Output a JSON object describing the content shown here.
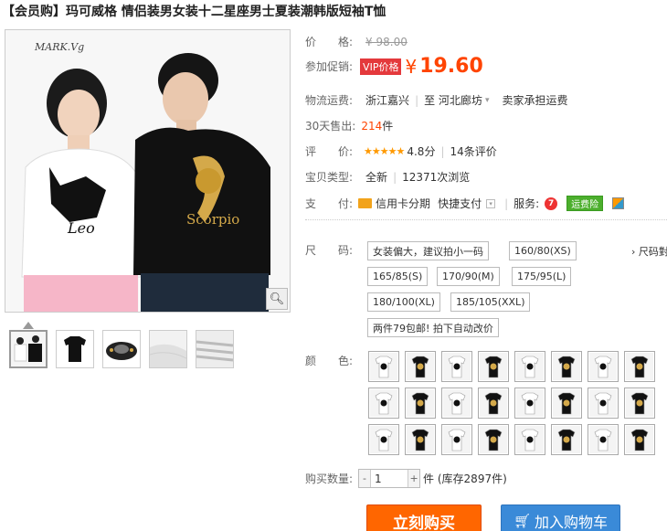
{
  "title": "【会员购】玛可威格 情侣装男女装十二星座男士夏装潮韩版短袖T恤",
  "product": {
    "price_label": "价　　格:",
    "old_price": "¥ 98.00",
    "promo_label": "参加促销:",
    "vip_badge": "VIP价格",
    "currency": "¥",
    "price": "19.60",
    "shipping_label": "物流运费:",
    "ship_from": "浙江嘉兴",
    "ship_to": "至  河北廊坊",
    "shipping_note": "卖家承担运费",
    "sold_label": "30天售出:",
    "sold_count": "214",
    "sold_unit": "件",
    "rating_label": "评　　价:",
    "stars": "★★★★★",
    "rating_score": "4.8分",
    "review_count": "14条评价",
    "type_label": "宝贝类型:",
    "type_value": "全新",
    "views": "12371次浏览",
    "pay_label": "支　　付:",
    "pay_credit": "信用卡分期",
    "pay_fast": "快捷支付",
    "service_label": "服务:",
    "service_badge": "运费险"
  },
  "photo": {
    "logo": "MARK.Vg",
    "left_print": "Leo",
    "right_print": "Scorpio"
  },
  "size": {
    "label": "尺　　码:",
    "hint": "女装偏大，建议拍小一码",
    "chart_link": "› 尺码對",
    "options": [
      "160/80(XS)",
      "165/85(S)",
      "170/90(M)",
      "175/95(L)",
      "180/100(XL)",
      "185/105(XXL)"
    ],
    "promo": "两件79包邮! 拍下自动改价"
  },
  "color": {
    "label": "颜　　色:"
  },
  "quantity": {
    "label": "购买数量:",
    "value": "1",
    "stock": "件 (库存2897件)"
  },
  "actions": {
    "buy": "立刻购买",
    "cart": "加入购物车"
  }
}
